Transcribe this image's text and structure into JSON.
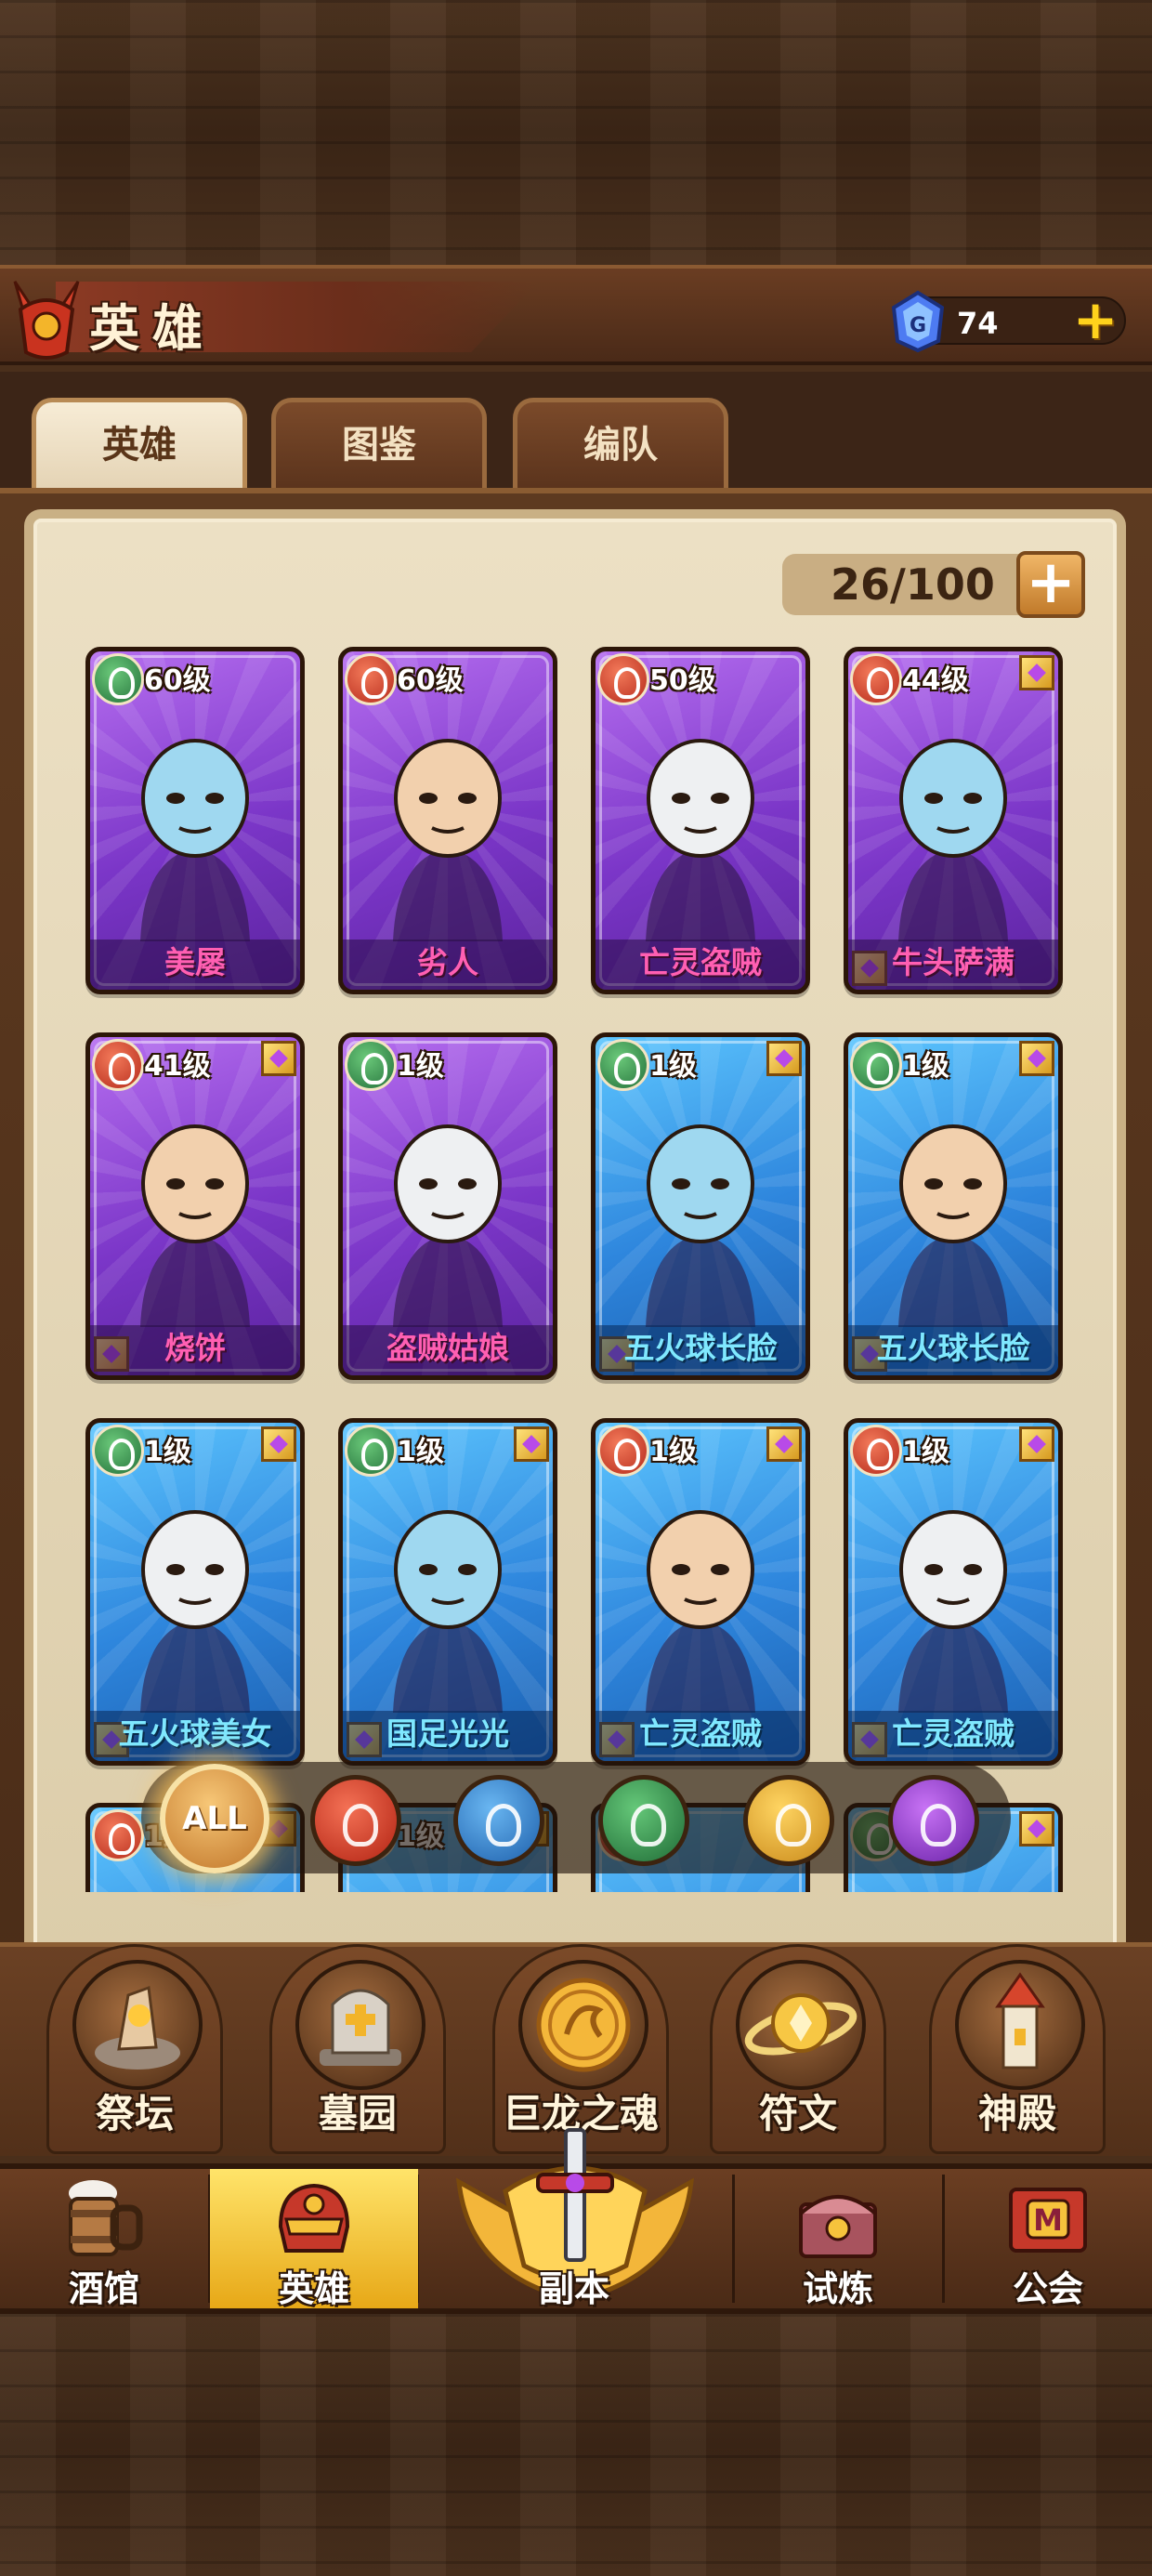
{
  "header": {
    "title": "英雄",
    "gems": "74"
  },
  "tabs": [
    {
      "label": "英雄",
      "active": true
    },
    {
      "label": "图鉴",
      "active": false
    },
    {
      "label": "编队",
      "active": false
    }
  ],
  "capacity": "26/100",
  "heroes": [
    {
      "level": "60级",
      "name": "美屡",
      "faction": "nature",
      "rarity": "purple"
    },
    {
      "level": "60级",
      "name": "劣人",
      "faction": "fire",
      "rarity": "purple"
    },
    {
      "level": "50级",
      "name": "亡灵盗贼",
      "faction": "fire",
      "rarity": "purple"
    },
    {
      "level": "44级",
      "name": "牛头萨满",
      "faction": "fire",
      "rarity": "purple"
    },
    {
      "level": "41级",
      "name": "烧饼",
      "faction": "fire",
      "rarity": "purple"
    },
    {
      "level": "1级",
      "name": "盗贼姑娘",
      "faction": "nature",
      "rarity": "purple"
    },
    {
      "level": "1级",
      "name": "五火球长脸",
      "faction": "nature",
      "rarity": "blue"
    },
    {
      "level": "1级",
      "name": "五火球长脸",
      "faction": "nature",
      "rarity": "blue"
    },
    {
      "level": "1级",
      "name": "五火球美女",
      "faction": "nature",
      "rarity": "blue"
    },
    {
      "level": "1级",
      "name": "国足光光",
      "faction": "nature",
      "rarity": "blue"
    },
    {
      "level": "1级",
      "name": "亡灵盗贼",
      "faction": "fire",
      "rarity": "blue"
    },
    {
      "level": "1级",
      "name": "亡灵盗贼",
      "faction": "fire",
      "rarity": "blue"
    },
    {
      "level": "1级",
      "name": "",
      "faction": "fire",
      "rarity": "blue"
    },
    {
      "level": "1级",
      "name": "",
      "faction": "nature",
      "rarity": "blue"
    },
    {
      "level": "",
      "name": "",
      "faction": "fire",
      "rarity": "blue"
    },
    {
      "level": "",
      "name": "",
      "faction": "nature",
      "rarity": "blue"
    }
  ],
  "filter": {
    "all_label": "ALL",
    "options": [
      "fire",
      "water",
      "nature",
      "light",
      "dark"
    ]
  },
  "features": [
    {
      "label": "祭坛",
      "icon": "altar-icon"
    },
    {
      "label": "墓园",
      "icon": "tombstone-icon"
    },
    {
      "label": "巨龙之魂",
      "icon": "dragon-coin-icon"
    },
    {
      "label": "符文",
      "icon": "rune-planet-icon"
    },
    {
      "label": "神殿",
      "icon": "temple-tower-icon"
    }
  ],
  "nav": [
    {
      "label": "酒馆",
      "icon": "tavern-icon"
    },
    {
      "label": "英雄",
      "icon": "hero-helmet-icon",
      "active": true
    },
    {
      "label": "副本",
      "icon": "dungeon-sword-icon"
    },
    {
      "label": "试炼",
      "icon": "trial-chest-icon"
    },
    {
      "label": "公会",
      "icon": "guild-banner-icon"
    }
  ],
  "colors": {
    "purple_name": "#ff5fb2",
    "blue_name": "#7fe8ff",
    "nav_active": "#ffe46a"
  }
}
